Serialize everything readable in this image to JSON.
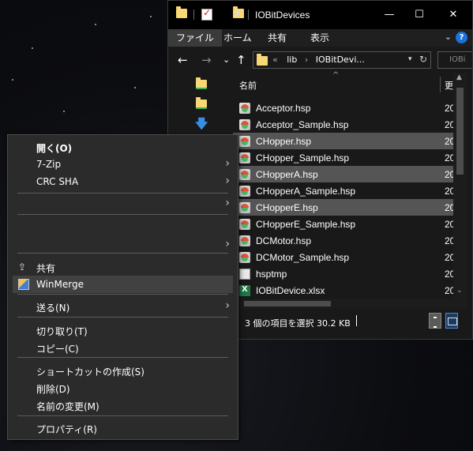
{
  "window": {
    "title": "IOBitDevices",
    "controls": {
      "minimize": "—",
      "maximize": "☐",
      "close": "✕"
    }
  },
  "ribbon": {
    "tabs": [
      "ファイル",
      "ホーム",
      "共有",
      "表示"
    ],
    "active_tab": "ファイル",
    "help": "?"
  },
  "navigation": {
    "back": "←",
    "forward": "→",
    "recent": "⌄",
    "up": "↑",
    "address": {
      "prefix": "«",
      "segments": [
        "lib",
        "IOBitDevi..."
      ]
    },
    "refresh": "↻",
    "search_placeholder": "IOBi"
  },
  "columns": {
    "name": "名前",
    "date": "更"
  },
  "files": [
    {
      "name": "Acceptor.hsp",
      "date": "20",
      "icon": "hsp-file-icon",
      "selected": false
    },
    {
      "name": "Acceptor_Sample.hsp",
      "date": "20",
      "icon": "hsp-file-icon",
      "selected": false
    },
    {
      "name": "CHopper.hsp",
      "date": "20",
      "icon": "hsp-file-icon",
      "selected": true
    },
    {
      "name": "CHopper_Sample.hsp",
      "date": "20",
      "icon": "hsp-file-icon",
      "selected": false
    },
    {
      "name": "CHopperA.hsp",
      "date": "20",
      "icon": "hsp-file-icon",
      "selected": true
    },
    {
      "name": "CHopperA_Sample.hsp",
      "date": "20",
      "icon": "hsp-file-icon",
      "selected": false
    },
    {
      "name": "CHopperE.hsp",
      "date": "20",
      "icon": "hsp-file-icon",
      "selected": true
    },
    {
      "name": "CHopperE_Sample.hsp",
      "date": "20",
      "icon": "hsp-file-icon",
      "selected": false
    },
    {
      "name": "DCMotor.hsp",
      "date": "20",
      "icon": "hsp-file-icon",
      "selected": false
    },
    {
      "name": "DCMotor_Sample.hsp",
      "date": "20",
      "icon": "hsp-file-icon",
      "selected": false
    },
    {
      "name": "hsptmp",
      "date": "20",
      "icon": "file-icon",
      "selected": false
    },
    {
      "name": "IOBitDevice.xlsx",
      "date": "20",
      "icon": "excel-file-icon",
      "selected": false
    }
  ],
  "status": {
    "text": "3 個の項目を選択  30.2 KB"
  },
  "context_menu": {
    "items": [
      {
        "label": "開く(O)",
        "bold": true
      },
      {
        "label": "7-Zip",
        "submenu": true
      },
      {
        "label": "CRC SHA",
        "submenu": true
      },
      {
        "label": "",
        "submenu": true
      },
      {
        "label": "",
        "submenu": true
      },
      {
        "label": "共有",
        "icon": "share-icon"
      },
      {
        "label": "WinMerge",
        "icon": "winmerge-icon",
        "highlighted": true
      },
      {
        "label": "送る(N)",
        "submenu": true
      },
      {
        "label": "切り取り(T)"
      },
      {
        "label": "コピー(C)"
      },
      {
        "label": "ショートカットの作成(S)"
      },
      {
        "label": "削除(D)"
      },
      {
        "label": "名前の変更(M)"
      },
      {
        "label": "プロパティ(R)"
      }
    ],
    "submenu_arrow": "›"
  },
  "colors": {
    "selection": "#555555",
    "menu_bg": "#2b2b2b",
    "menu_hover": "#414141",
    "folder": "#f8d775",
    "accent_blue": "#1a73d9"
  }
}
